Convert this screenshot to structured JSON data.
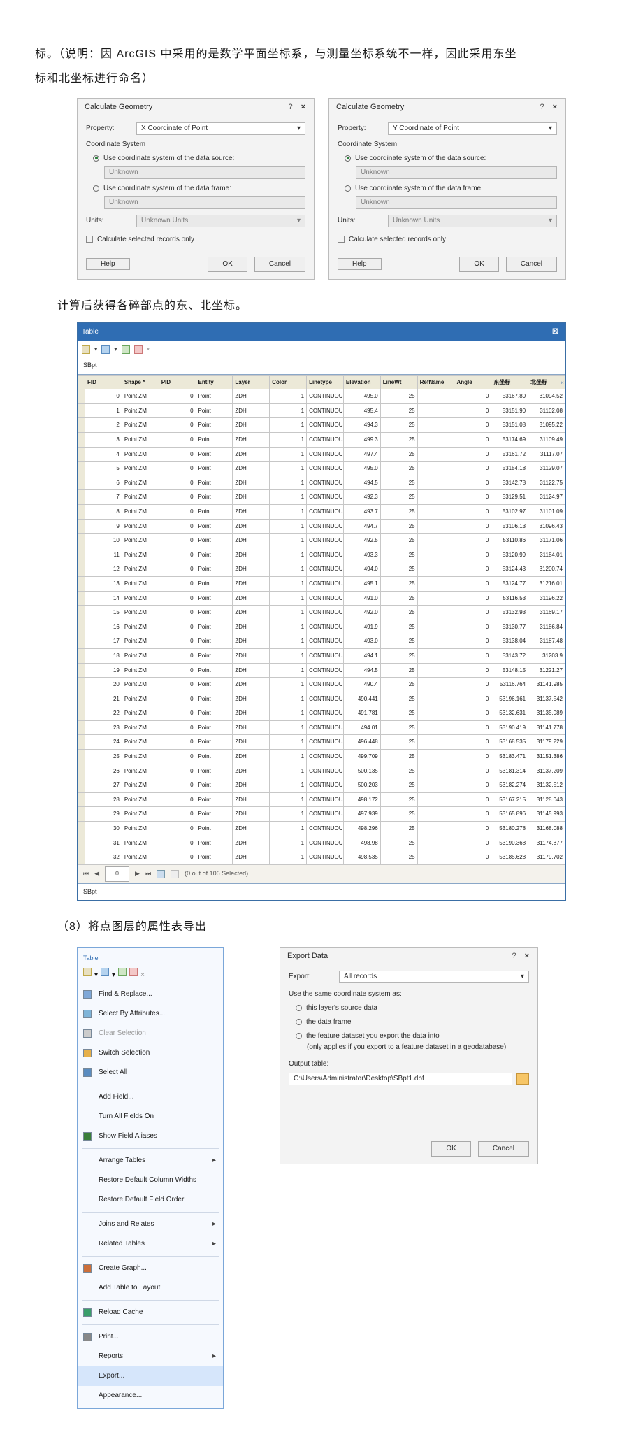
{
  "intro_line1": "标。（说明：因 ArcGIS 中采用的是数学平面坐标系，与测量坐标系统不一样，因此采用东坐",
  "intro_line2": "标和北坐标进行命名）",
  "calcX": {
    "title": "Calculate Geometry",
    "property_label": "Property:",
    "property_value": "X Coordinate of Point",
    "coord_sys_label": "Coordinate System",
    "opt1": "Use coordinate system of the data source:",
    "opt1_val": "Unknown",
    "opt2": "Use coordinate system of the data frame:",
    "opt2_val": "Unknown",
    "units_label": "Units:",
    "units_value": "Unknown Units",
    "chk": "Calculate selected records only",
    "help": "Help",
    "ok": "OK",
    "cancel": "Cancel"
  },
  "calcY": {
    "title": "Calculate Geometry",
    "property_label": "Property:",
    "property_value": "Y Coordinate of Point",
    "coord_sys_label": "Coordinate System",
    "opt1": "Use coordinate system of the data source:",
    "opt1_val": "Unknown",
    "opt2": "Use coordinate system of the data frame:",
    "opt2_val": "Unknown",
    "units_label": "Units:",
    "units_value": "Unknown Units",
    "chk": "Calculate selected records only",
    "help": "Help",
    "ok": "OK",
    "cancel": "Cancel"
  },
  "mid_text": "计算后获得各碎部点的东、北坐标。",
  "table": {
    "title": "Table",
    "tab": "SBpt",
    "headers": [
      "FID",
      "Shape *",
      "PID",
      "Entity",
      "Layer",
      "Color",
      "Linetype",
      "Elevation",
      "LineWt",
      "RefName",
      "Angle",
      "东坐标",
      "北坐标"
    ],
    "footer_counter": "0",
    "footer_sel": "(0 out of 106 Selected)",
    "footer_tab": "SBpt",
    "rows": [
      [
        "0",
        "Point ZM",
        "0",
        "Point",
        "ZDH",
        "1",
        "CONTINUOUS",
        "495.0",
        "25",
        "",
        "0",
        "53167.80",
        "31094.52"
      ],
      [
        "1",
        "Point ZM",
        "0",
        "Point",
        "ZDH",
        "1",
        "CONTINUOUS",
        "495.4",
        "25",
        "",
        "0",
        "53151.90",
        "31102.08"
      ],
      [
        "2",
        "Point ZM",
        "0",
        "Point",
        "ZDH",
        "1",
        "CONTINUOUS",
        "494.3",
        "25",
        "",
        "0",
        "53151.08",
        "31095.22"
      ],
      [
        "3",
        "Point ZM",
        "0",
        "Point",
        "ZDH",
        "1",
        "CONTINUOUS",
        "499.3",
        "25",
        "",
        "0",
        "53174.69",
        "31109.49"
      ],
      [
        "4",
        "Point ZM",
        "0",
        "Point",
        "ZDH",
        "1",
        "CONTINUOUS",
        "497.4",
        "25",
        "",
        "0",
        "53161.72",
        "31117.07"
      ],
      [
        "5",
        "Point ZM",
        "0",
        "Point",
        "ZDH",
        "1",
        "CONTINUOUS",
        "495.0",
        "25",
        "",
        "0",
        "53154.18",
        "31129.07"
      ],
      [
        "6",
        "Point ZM",
        "0",
        "Point",
        "ZDH",
        "1",
        "CONTINUOUS",
        "494.5",
        "25",
        "",
        "0",
        "53142.78",
        "31122.75"
      ],
      [
        "7",
        "Point ZM",
        "0",
        "Point",
        "ZDH",
        "1",
        "CONTINUOUS",
        "492.3",
        "25",
        "",
        "0",
        "53129.51",
        "31124.97"
      ],
      [
        "8",
        "Point ZM",
        "0",
        "Point",
        "ZDH",
        "1",
        "CONTINUOUS",
        "493.7",
        "25",
        "",
        "0",
        "53102.97",
        "31101.09"
      ],
      [
        "9",
        "Point ZM",
        "0",
        "Point",
        "ZDH",
        "1",
        "CONTINUOUS",
        "494.7",
        "25",
        "",
        "0",
        "53106.13",
        "31096.43"
      ],
      [
        "10",
        "Point ZM",
        "0",
        "Point",
        "ZDH",
        "1",
        "CONTINUOUS",
        "492.5",
        "25",
        "",
        "0",
        "53110.86",
        "31171.06"
      ],
      [
        "11",
        "Point ZM",
        "0",
        "Point",
        "ZDH",
        "1",
        "CONTINUOUS",
        "493.3",
        "25",
        "",
        "0",
        "53120.99",
        "31184.01"
      ],
      [
        "12",
        "Point ZM",
        "0",
        "Point",
        "ZDH",
        "1",
        "CONTINUOUS",
        "494.0",
        "25",
        "",
        "0",
        "53124.43",
        "31200.74"
      ],
      [
        "13",
        "Point ZM",
        "0",
        "Point",
        "ZDH",
        "1",
        "CONTINUOUS",
        "495.1",
        "25",
        "",
        "0",
        "53124.77",
        "31216.01"
      ],
      [
        "14",
        "Point ZM",
        "0",
        "Point",
        "ZDH",
        "1",
        "CONTINUOUS",
        "491.0",
        "25",
        "",
        "0",
        "53116.53",
        "31196.22"
      ],
      [
        "15",
        "Point ZM",
        "0",
        "Point",
        "ZDH",
        "1",
        "CONTINUOUS",
        "492.0",
        "25",
        "",
        "0",
        "53132.93",
        "31169.17"
      ],
      [
        "16",
        "Point ZM",
        "0",
        "Point",
        "ZDH",
        "1",
        "CONTINUOUS",
        "491.9",
        "25",
        "",
        "0",
        "53130.77",
        "31186.84"
      ],
      [
        "17",
        "Point ZM",
        "0",
        "Point",
        "ZDH",
        "1",
        "CONTINUOUS",
        "493.0",
        "25",
        "",
        "0",
        "53138.04",
        "31187.48"
      ],
      [
        "18",
        "Point ZM",
        "0",
        "Point",
        "ZDH",
        "1",
        "CONTINUOUS",
        "494.1",
        "25",
        "",
        "0",
        "53143.72",
        "31203.9"
      ],
      [
        "19",
        "Point ZM",
        "0",
        "Point",
        "ZDH",
        "1",
        "CONTINUOUS",
        "494.5",
        "25",
        "",
        "0",
        "53148.15",
        "31221.27"
      ],
      [
        "20",
        "Point ZM",
        "0",
        "Point",
        "ZDH",
        "1",
        "CONTINUOUS",
        "490.4",
        "25",
        "",
        "0",
        "53116.764",
        "31141.985"
      ],
      [
        "21",
        "Point ZM",
        "0",
        "Point",
        "ZDH",
        "1",
        "CONTINUOUS",
        "490.441",
        "25",
        "",
        "0",
        "53196.161",
        "31137.542"
      ],
      [
        "22",
        "Point ZM",
        "0",
        "Point",
        "ZDH",
        "1",
        "CONTINUOUS",
        "491.781",
        "25",
        "",
        "0",
        "53132.631",
        "31135.089"
      ],
      [
        "23",
        "Point ZM",
        "0",
        "Point",
        "ZDH",
        "1",
        "CONTINUOUS",
        "494.01",
        "25",
        "",
        "0",
        "53190.419",
        "31141.778"
      ],
      [
        "24",
        "Point ZM",
        "0",
        "Point",
        "ZDH",
        "1",
        "CONTINUOUS",
        "496.448",
        "25",
        "",
        "0",
        "53168.535",
        "31179.229"
      ],
      [
        "25",
        "Point ZM",
        "0",
        "Point",
        "ZDH",
        "1",
        "CONTINUOUS",
        "499.709",
        "25",
        "",
        "0",
        "53183.471",
        "31151.386"
      ],
      [
        "26",
        "Point ZM",
        "0",
        "Point",
        "ZDH",
        "1",
        "CONTINUOUS",
        "500.135",
        "25",
        "",
        "0",
        "53181.314",
        "31137.209"
      ],
      [
        "27",
        "Point ZM",
        "0",
        "Point",
        "ZDH",
        "1",
        "CONTINUOUS",
        "500.203",
        "25",
        "",
        "0",
        "53182.274",
        "31132.512"
      ],
      [
        "28",
        "Point ZM",
        "0",
        "Point",
        "ZDH",
        "1",
        "CONTINUOUS",
        "498.172",
        "25",
        "",
        "0",
        "53167.215",
        "31128.043"
      ],
      [
        "29",
        "Point ZM",
        "0",
        "Point",
        "ZDH",
        "1",
        "CONTINUOUS",
        "497.939",
        "25",
        "",
        "0",
        "53165.896",
        "31145.993"
      ],
      [
        "30",
        "Point ZM",
        "0",
        "Point",
        "ZDH",
        "1",
        "CONTINUOUS",
        "498.296",
        "25",
        "",
        "0",
        "53180.278",
        "31168.088"
      ],
      [
        "31",
        "Point ZM",
        "0",
        "Point",
        "ZDH",
        "1",
        "CONTINUOUS",
        "498.98",
        "25",
        "",
        "0",
        "53190.368",
        "31174.877"
      ],
      [
        "32",
        "Point ZM",
        "0",
        "Point",
        "ZDH",
        "1",
        "CONTINUOUS",
        "498.535",
        "25",
        "",
        "0",
        "53185.628",
        "31179.702"
      ]
    ]
  },
  "section8": "（8）将点图层的属性表导出",
  "menu": {
    "title": "Table",
    "items": [
      {
        "label": "Find & Replace...",
        "icon": "find",
        "en": true
      },
      {
        "label": "Select By Attributes...",
        "icon": "select-attr",
        "en": true
      },
      {
        "label": "Clear Selection",
        "icon": "clear",
        "en": false
      },
      {
        "label": "Switch Selection",
        "icon": "switch",
        "en": true
      },
      {
        "label": "Select All",
        "icon": "select-all",
        "en": true
      },
      {
        "sep": true
      },
      {
        "label": "Add Field...",
        "en": true
      },
      {
        "label": "Turn All Fields On",
        "en": true
      },
      {
        "label": "Show Field Aliases",
        "icon": "check",
        "en": true
      },
      {
        "sep": true
      },
      {
        "label": "Arrange Tables",
        "arrow": true,
        "en": true
      },
      {
        "label": "Restore Default Column Widths",
        "en": true
      },
      {
        "label": "Restore Default Field Order",
        "en": true
      },
      {
        "sep": true
      },
      {
        "label": "Joins and Relates",
        "arrow": true,
        "en": true
      },
      {
        "label": "Related Tables",
        "arrow": true,
        "en": true
      },
      {
        "sep": true
      },
      {
        "label": "Create Graph...",
        "icon": "graph",
        "en": true
      },
      {
        "label": "Add Table to Layout",
        "en": true
      },
      {
        "sep": true
      },
      {
        "label": "Reload Cache",
        "icon": "reload",
        "en": true
      },
      {
        "sep": true
      },
      {
        "label": "Print...",
        "icon": "print",
        "en": true
      },
      {
        "label": "Reports",
        "arrow": true,
        "en": true
      },
      {
        "label": "Export...",
        "highlight": true,
        "en": true
      },
      {
        "label": "Appearance...",
        "en": true
      }
    ]
  },
  "export": {
    "title": "Export Data",
    "export_label": "Export:",
    "export_value": "All records",
    "use_label": "Use the same coordinate system as:",
    "opt1": "this layer's source data",
    "opt2": "the data frame",
    "opt3a": "the feature dataset you export the data into",
    "opt3b": "(only applies if you export to a feature dataset in a geodatabase)",
    "output_label": "Output table:",
    "output_value": "C:\\Users\\Administrator\\Desktop\\SBpt1.dbf",
    "ok": "OK",
    "cancel": "Cancel"
  }
}
